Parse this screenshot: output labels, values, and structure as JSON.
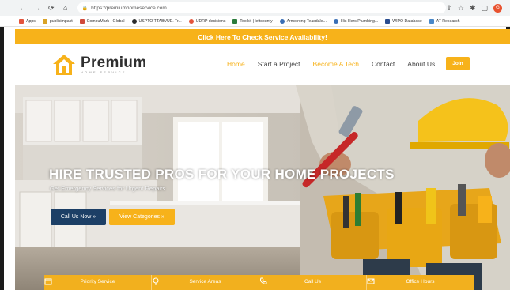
{
  "browser": {
    "url": "https://premiumhomeservice.com",
    "bookmarks": [
      {
        "label": "Apps",
        "color": "#e3543c"
      },
      {
        "label": "publicimpact",
        "color": "#d9a326"
      },
      {
        "label": "CompuMark - Global",
        "color": "#d04a3b"
      },
      {
        "label": "USPTO TTABVUE. Tr...",
        "color": "#2c2c2c"
      },
      {
        "label": "UDRP decisions",
        "color": "#e3543c"
      },
      {
        "label": "Toolkit | leftcounty",
        "color": "#2c7c3c"
      },
      {
        "label": "Armstrong Teasdale...",
        "color": "#3a6fb5"
      },
      {
        "label": "His Hers Plumbing...",
        "color": "#3a6fb5"
      },
      {
        "label": "WIPO Database",
        "color": "#2a4d8f"
      },
      {
        "label": "AT Research",
        "color": "#4a88c8"
      }
    ],
    "icons": [
      "back-icon",
      "forward-icon",
      "reload-icon",
      "home-icon",
      "share-icon",
      "star-icon",
      "extension-icon",
      "window-icon"
    ],
    "avatar_letter": "G"
  },
  "banner": {
    "text": "Click Here To Check Service Availability!"
  },
  "logo": {
    "name": "Premium",
    "subtitle": "HOME SERVICE"
  },
  "menu": {
    "items": [
      "Home",
      "Start a Project",
      "Become A Tech",
      "Contact",
      "About Us"
    ],
    "join": "Join"
  },
  "hero": {
    "title": "HIRE TRUSTED PROS FOR YOUR HOME PROJECTS",
    "subtitle": "Get Emergency Services for Urgent Repairs",
    "call_button": "Call Us Now »",
    "categories_button": "View Categories »"
  },
  "infobar": {
    "items": [
      "Priority Service",
      "Service Areas",
      "Call Us",
      "Office Hours"
    ]
  },
  "colors": {
    "accent": "#f7b21a",
    "navy": "#1c3f66"
  }
}
